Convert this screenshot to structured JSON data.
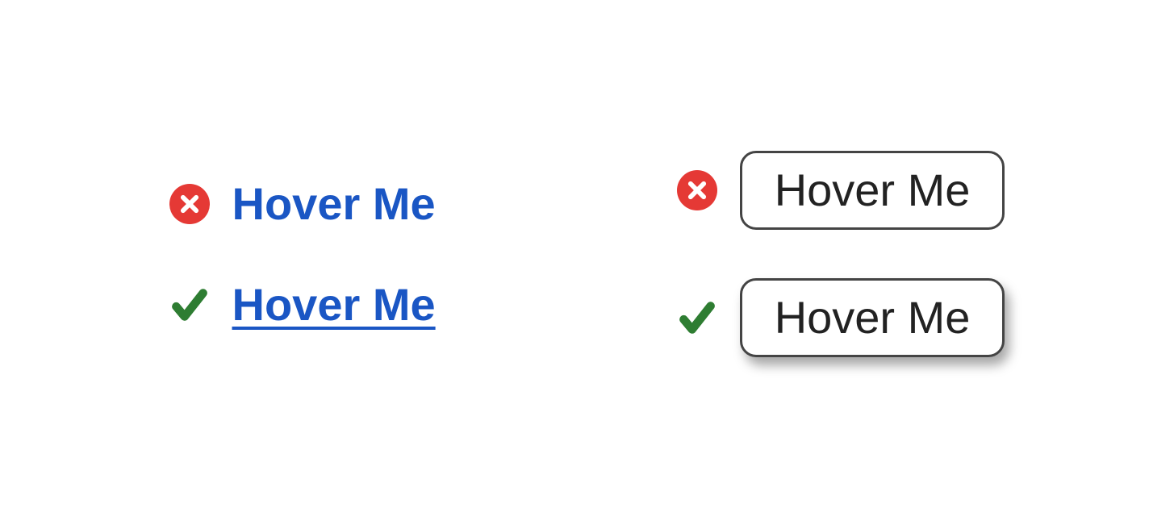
{
  "examples": {
    "link_plain": {
      "text": "Hover Me"
    },
    "link_underlined": {
      "text": "Hover Me"
    },
    "button_plain": {
      "text": "Hover Me"
    },
    "button_shadow": {
      "text": "Hover Me"
    }
  },
  "colors": {
    "error": "#e53935",
    "success": "#2e7d32",
    "link": "#1a56c4"
  }
}
